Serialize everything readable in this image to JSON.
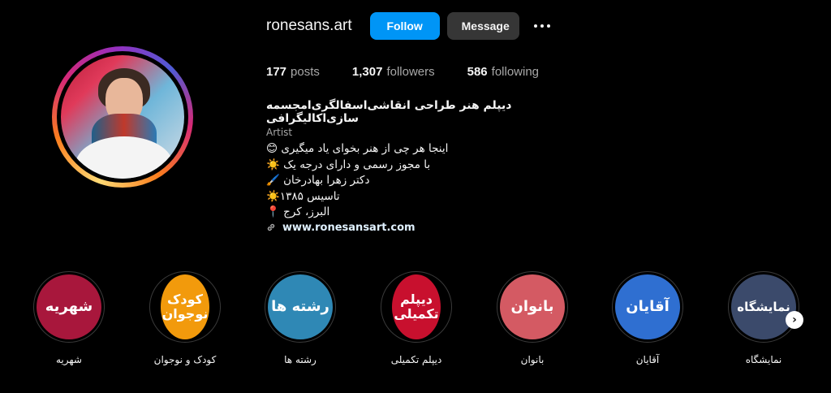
{
  "profile": {
    "username": "ronesans.art",
    "follow_label": "Follow",
    "message_label": "Message"
  },
  "stats": [
    {
      "value": "177",
      "label": "posts"
    },
    {
      "value": "1,307",
      "label": "followers"
    },
    {
      "value": "586",
      "label": "following"
    }
  ],
  "bio": {
    "name": "دیپلم هنر طراحی انقاشی‌اسفالگری‌امجسمه سازی‌اکالیگرافی",
    "category": "Artist",
    "lines": [
      "اینجا هر چی از هنر بخوای یاد میگیری 😊",
      "با مجوز رسمی و دارای درجه یک ☀️",
      "دکتر زهرا بهادرخان 🖌️",
      "تاسیس ۱۳۸۵☀️",
      "البرز، کرج 📍"
    ],
    "link": "www.ronesansart.com"
  },
  "highlights": [
    {
      "text": "شهریه",
      "label": "شهریه",
      "color": "#a8173c"
    },
    {
      "text": "کودک نوجوان",
      "label": "کودک و نوجوان",
      "color": "#f29a0c"
    },
    {
      "text": "رشته ها",
      "label": "رشته ها",
      "color": "#2f88b5"
    },
    {
      "text": "دیپلم تکمیلی",
      "label": "دیپلم تکمیلی",
      "color": "#c8102e"
    },
    {
      "text": "بانوان",
      "label": "بانوان",
      "color": "#d45a63"
    },
    {
      "text": "آقایان",
      "label": "آقایان",
      "color": "#2f6fd1"
    },
    {
      "text": "نمایشگاه",
      "label": "نمایشگاه",
      "color": "#3b4a6b"
    }
  ],
  "icons": {
    "more": "more-dots-icon",
    "link": "link-icon",
    "next": "chevron-right-icon"
  }
}
